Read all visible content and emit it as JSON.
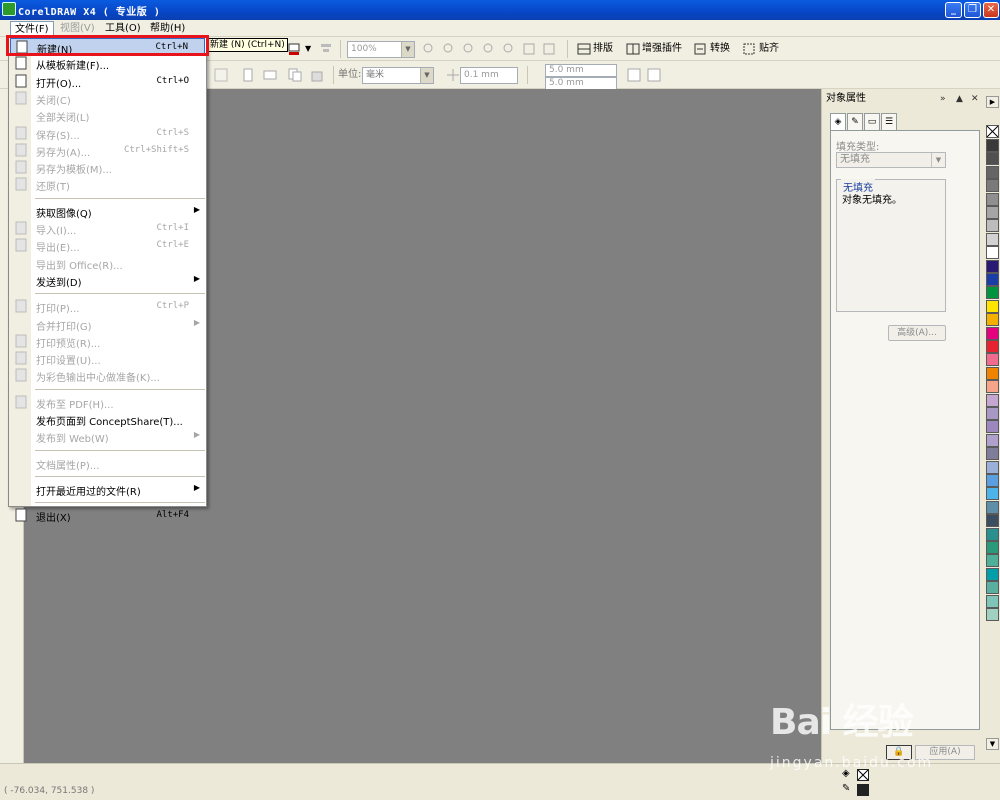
{
  "window": {
    "title": "CorelDRAW X4 ( 专业版 )"
  },
  "menubar": {
    "items": [
      {
        "label": "文件(F)",
        "state": "active"
      },
      {
        "label": "视图(V)",
        "state": "disabled"
      },
      {
        "label": "工具(O)",
        "state": "normal"
      },
      {
        "label": "帮助(H)",
        "state": "normal"
      }
    ]
  },
  "tooltip": "新建 (N) (Ctrl+N)",
  "toolbar1": {
    "zoom_value": "100%",
    "buttons": [
      "排版",
      "增强插件",
      "转换",
      "贴齐"
    ]
  },
  "toolbar2": {
    "unit_label": "单位:",
    "unit_value": "毫米",
    "nudge_value": "0.1 mm",
    "dup_x": "5.0 mm",
    "dup_y": "5.0 mm"
  },
  "file_menu": {
    "items": [
      {
        "label": "新建(N)",
        "shortcut": "Ctrl+N",
        "disabled": false,
        "highlighted": true,
        "submenu": false,
        "icon": "new-doc-icon"
      },
      {
        "label": "从模板新建(F)...",
        "shortcut": "",
        "disabled": false,
        "submenu": false,
        "icon": "template-icon"
      },
      {
        "label": "打开(O)...",
        "shortcut": "Ctrl+O",
        "disabled": false,
        "submenu": false,
        "icon": "open-folder-icon"
      },
      {
        "label": "关闭(C)",
        "shortcut": "",
        "disabled": true,
        "submenu": false,
        "icon": "close-doc-icon"
      },
      {
        "label": "全部关闭(L)",
        "shortcut": "",
        "disabled": true,
        "submenu": false,
        "icon": ""
      },
      {
        "label": "保存(S)...",
        "shortcut": "Ctrl+S",
        "disabled": true,
        "submenu": false,
        "icon": "save-icon"
      },
      {
        "label": "另存为(A)...",
        "shortcut": "Ctrl+Shift+S",
        "disabled": true,
        "submenu": false,
        "icon": "save-as-icon"
      },
      {
        "label": "另存为模板(M)...",
        "shortcut": "",
        "disabled": true,
        "submenu": false,
        "icon": "save-template-icon"
      },
      {
        "label": "还原(T)",
        "shortcut": "",
        "disabled": true,
        "submenu": false,
        "icon": "revert-icon"
      },
      {
        "label": "获取图像(Q)",
        "shortcut": "",
        "disabled": false,
        "submenu": true,
        "icon": "",
        "sep_before": true
      },
      {
        "label": "导入(I)...",
        "shortcut": "Ctrl+I",
        "disabled": true,
        "submenu": false,
        "icon": "import-icon"
      },
      {
        "label": "导出(E)...",
        "shortcut": "Ctrl+E",
        "disabled": true,
        "submenu": false,
        "icon": "export-icon"
      },
      {
        "label": "导出到 Office(R)...",
        "shortcut": "",
        "disabled": true,
        "submenu": false,
        "icon": ""
      },
      {
        "label": "发送到(D)",
        "shortcut": "",
        "disabled": false,
        "submenu": true,
        "icon": ""
      },
      {
        "label": "打印(P)...",
        "shortcut": "Ctrl+P",
        "disabled": true,
        "submenu": false,
        "icon": "print-icon",
        "sep_before": true
      },
      {
        "label": "合并打印(G)",
        "shortcut": "",
        "disabled": true,
        "submenu": true,
        "icon": ""
      },
      {
        "label": "打印预览(R)...",
        "shortcut": "",
        "disabled": true,
        "submenu": false,
        "icon": "print-preview-icon"
      },
      {
        "label": "打印设置(U)...",
        "shortcut": "",
        "disabled": true,
        "submenu": false,
        "icon": "print-setup-icon"
      },
      {
        "label": "为彩色输出中心做准备(K)...",
        "shortcut": "",
        "disabled": true,
        "submenu": false,
        "icon": "color-output-icon"
      },
      {
        "label": "发布至 PDF(H)...",
        "shortcut": "",
        "disabled": true,
        "submenu": false,
        "icon": "pdf-icon",
        "sep_before": true
      },
      {
        "label": "发布页面到 ConceptShare(T)...",
        "shortcut": "",
        "disabled": false,
        "submenu": false,
        "icon": ""
      },
      {
        "label": "发布到 Web(W)",
        "shortcut": "",
        "disabled": true,
        "submenu": true,
        "icon": ""
      },
      {
        "label": "文档属性(P)...",
        "shortcut": "",
        "disabled": true,
        "submenu": false,
        "icon": "",
        "sep_before": true
      },
      {
        "label": "打开最近用过的文件(R)",
        "shortcut": "",
        "disabled": false,
        "submenu": true,
        "icon": "",
        "sep_before": true
      },
      {
        "label": "退出(X)",
        "shortcut": "Alt+F4",
        "disabled": false,
        "submenu": false,
        "icon": "exit-icon",
        "sep_before": true
      }
    ]
  },
  "docker": {
    "title": "对象属性",
    "fill_type_label": "填充类型:",
    "fill_type_value": "无填充",
    "fill_box_title": "无填充",
    "fill_box_text": "对象无填充。",
    "advanced_label": "高级(A)...",
    "apply_label": "应用(A)"
  },
  "palette": {
    "colors": [
      "#3a3a3a",
      "#505050",
      "#656565",
      "#7a7a7a",
      "#8f8f8f",
      "#a5a5a5",
      "#bcbcbc",
      "#d2d2d2",
      "#ffffff",
      "#2b1a74",
      "#1b3ea6",
      "#00943c",
      "#ffe400",
      "#f4b000",
      "#e4007e",
      "#e6232e",
      "#f06b8f",
      "#f08300",
      "#f5a48a",
      "#c3a7d0",
      "#a898c4",
      "#9c88bd",
      "#b0a0cc",
      "#7e7e9a",
      "#9ab0d8",
      "#5aa0e0",
      "#4cb4e8",
      "#5f8ea8",
      "#3d4d60",
      "#2a8f8f",
      "#2a9a7a",
      "#4fb09a",
      "#009ea8",
      "#5ab0a0",
      "#7ec4b8",
      "#a0d0c0"
    ]
  },
  "status": {
    "coords": "( -76.034, 751.538 )"
  },
  "watermark": {
    "main": "Bai 经验",
    "sub": "jingyan.baidu.com"
  }
}
